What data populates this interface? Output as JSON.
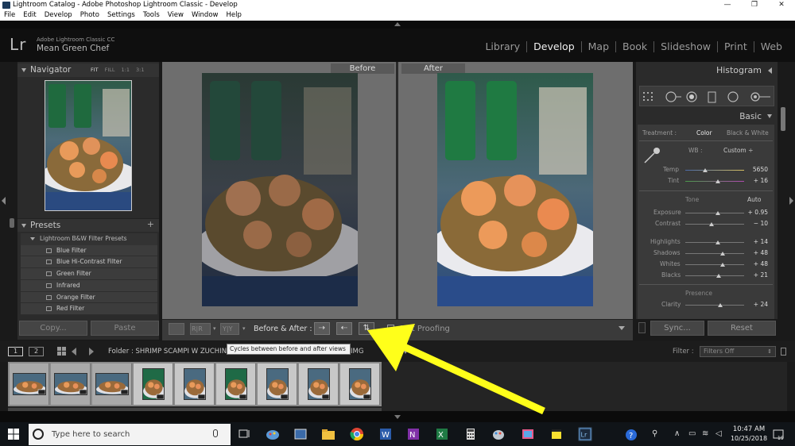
{
  "window": {
    "title": "Lightroom Catalog - Adobe Photoshop Lightroom Classic - Develop",
    "controls": [
      "minimize-icon",
      "maximize-icon",
      "close-icon"
    ]
  },
  "menu": [
    "File",
    "Edit",
    "Develop",
    "Photo",
    "Settings",
    "Tools",
    "View",
    "Window",
    "Help"
  ],
  "identity": {
    "logo": "Lr",
    "app_name": "Adobe Lightroom Classic CC",
    "user": "Mean Green Chef"
  },
  "modules": [
    {
      "label": "Library",
      "active": false
    },
    {
      "label": "Develop",
      "active": true
    },
    {
      "label": "Map",
      "active": false
    },
    {
      "label": "Book",
      "active": false
    },
    {
      "label": "Slideshow",
      "active": false
    },
    {
      "label": "Print",
      "active": false
    },
    {
      "label": "Web",
      "active": false
    }
  ],
  "navigator": {
    "title": "Navigator",
    "zoom": [
      "FIT",
      "FILL",
      "1:1",
      "3:1"
    ]
  },
  "presets": {
    "title": "Presets",
    "add": "+",
    "group": "Lightroom B&W Filter Presets",
    "items": [
      "Blue Filter",
      "Blue Hi-Contrast Filter",
      "Green Filter",
      "Infrared",
      "Orange Filter",
      "Red Filter"
    ]
  },
  "left_buttons": {
    "copy": "Copy...",
    "paste": "Paste"
  },
  "view": {
    "before": "Before",
    "after": "After"
  },
  "toolbar": {
    "rr": "R|R",
    "yy": "Y|Y",
    "ba_label": "Before & After :",
    "swap1": "⇢",
    "swap2": "⇠",
    "swap3": "⇅",
    "soft_proofing": "Soft Proofing"
  },
  "right_panel": {
    "histogram": "Histogram",
    "basic": "Basic",
    "treatment_label": "Treatment :",
    "treatment_color": "Color",
    "treatment_bw": "Black & White",
    "wb_label": "WB :",
    "wb_value": "Custom ÷",
    "temp_label": "Temp",
    "temp_value": "5650",
    "tint_label": "Tint",
    "tint_value": "+ 16",
    "tone_label": "Tone",
    "tone_auto": "Auto",
    "exposure_label": "Exposure",
    "exposure_value": "+ 0.95",
    "contrast_label": "Contrast",
    "contrast_value": "− 10",
    "highlights_label": "Highlights",
    "highlights_value": "+ 14",
    "shadows_label": "Shadows",
    "shadows_value": "+ 48",
    "whites_label": "Whites",
    "whites_value": "+ 48",
    "blacks_label": "Blacks",
    "blacks_value": "+ 21",
    "presence_label": "Presence",
    "clarity_label": "Clarity",
    "clarity_value": "+ 24",
    "sliders": {
      "temp": 0.34,
      "tint": 0.56,
      "exposure": 0.55,
      "contrast": 0.45,
      "highlights": 0.55,
      "shadows": 0.64,
      "whites": 0.64,
      "blacks": 0.57,
      "clarity": 0.59
    }
  },
  "right_buttons": {
    "sync": "Sync...",
    "reset": "Reset"
  },
  "filmstrip": {
    "page1": "1",
    "page2": "2",
    "folder": "Folder : SHRIMP SCAMPI W ZUCHINI",
    "folder_end": "IMG",
    "tooltip": "Cycles between before and after views",
    "filter_label": "Filter :",
    "filter_value": "Filters Off"
  },
  "taskbar": {
    "search_placeholder": "Type here to search",
    "time": "10:47 AM",
    "date": "10/25/2018",
    "notifications": "19"
  },
  "colors": {
    "accent_arrow": "#ffff1a",
    "panel_bg": "#2b2b2b",
    "taskbar_bg": "#101418"
  }
}
